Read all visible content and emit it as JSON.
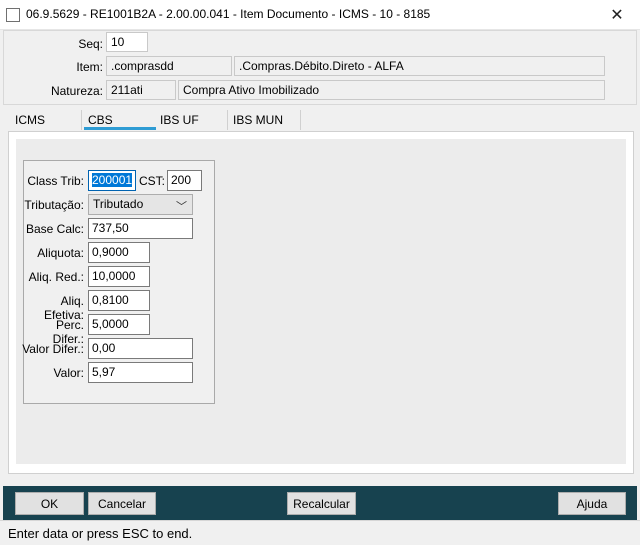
{
  "window": {
    "title": "06.9.5629 - RE1001B2A - 2.00.00.041 - Item Documento - ICMS - 10 - 8185",
    "close_glyph": "✕"
  },
  "header": {
    "seq_label": "Seq:",
    "seq_value": "10",
    "item_label": "Item:",
    "item_code": ".comprasdd",
    "item_desc": ".Compras.Débito.Direto - ALFA",
    "natureza_label": "Natureza:",
    "natureza_code": "211ati",
    "natureza_desc": "Compra Ativo Imobilizado"
  },
  "tabs": [
    "ICMS",
    "CBS",
    "IBS UF",
    "IBS MUN"
  ],
  "active_tab": "CBS",
  "form": {
    "class_trib_label": "Class Trib:",
    "class_trib_value": "200001",
    "cst_label": "CST:",
    "cst_value": "200",
    "tributacao_label": "Tributação:",
    "tributacao_value": "Tributado",
    "base_calc_label": "Base Calc:",
    "base_calc_value": "737,50",
    "aliquota_label": "Aliquota:",
    "aliquota_value": "0,9000",
    "aliq_red_label": "Aliq. Red.:",
    "aliq_red_value": "10,0000",
    "aliq_efetiva_label": "Aliq. Efetiva:",
    "aliq_efetiva_value": "0,8100",
    "perc_difer_label": "Perc. Difer.:",
    "perc_difer_value": "5,0000",
    "valor_difer_label": "Valor Difer.:",
    "valor_difer_value": "0,00",
    "valor_label": "Valor:",
    "valor_value": "5,97"
  },
  "buttons": {
    "ok": "OK",
    "cancelar": "Cancelar",
    "recalcular": "Recalcular",
    "ajuda": "Ajuda"
  },
  "status": "Enter data or press ESC to end.",
  "colors": {
    "active_tab_accent": "#2e9cd4",
    "button_bar": "#17424f",
    "selection": "#0078d7"
  }
}
